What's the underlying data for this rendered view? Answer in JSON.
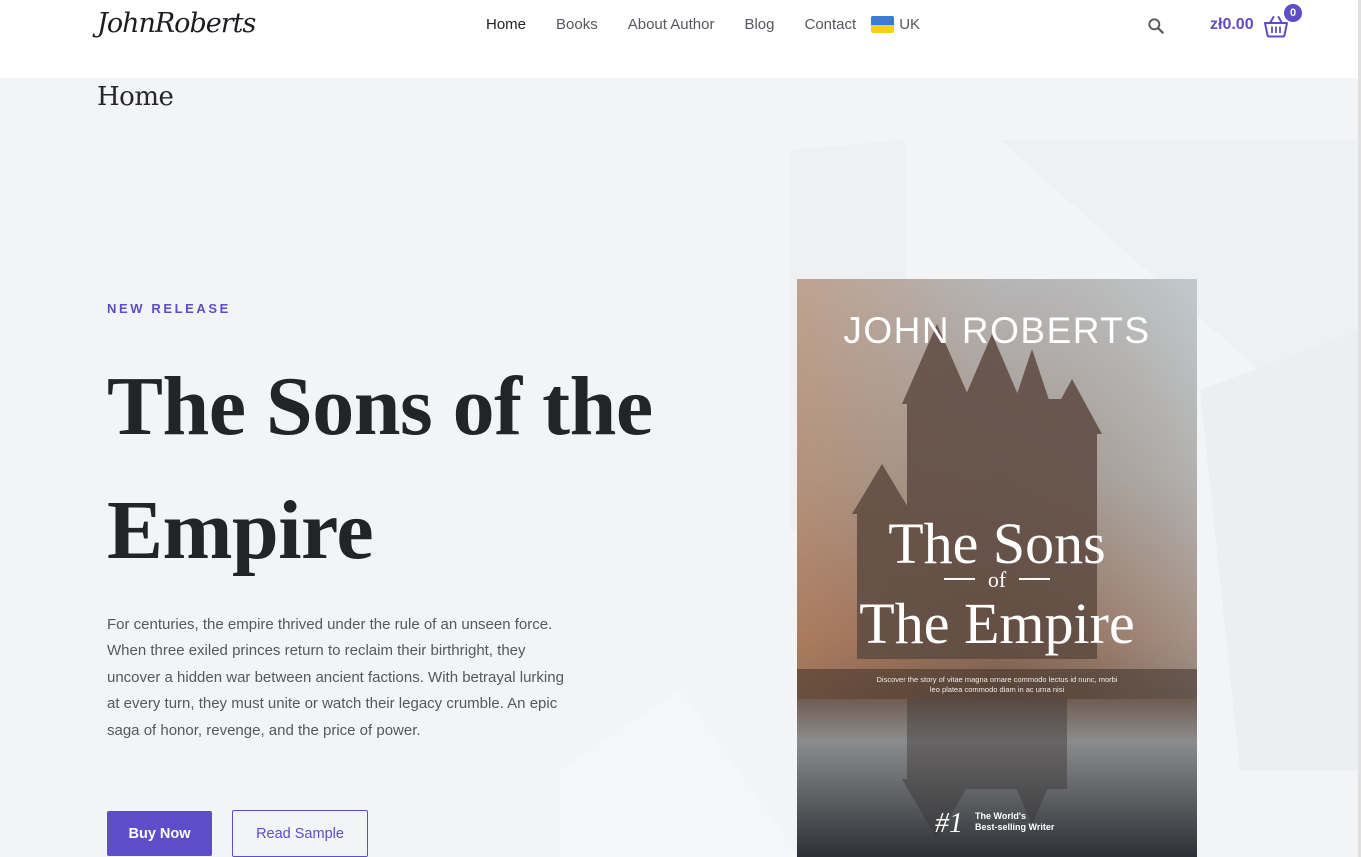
{
  "header": {
    "logo": "JohnRoberts",
    "nav": [
      {
        "label": "Home",
        "active": true
      },
      {
        "label": "Books",
        "active": false
      },
      {
        "label": "About Author",
        "active": false
      },
      {
        "label": "Blog",
        "active": false
      },
      {
        "label": "Contact",
        "active": false
      }
    ],
    "language": {
      "label": "UK",
      "flag": "ukraine-flag"
    },
    "search_icon": "search-icon",
    "cart": {
      "price": "zł0.00",
      "count": "0",
      "icon": "basket-icon"
    }
  },
  "breadcrumb": "Home",
  "hero": {
    "eyebrow": "NEW RELEASE",
    "title": "The Sons of the Empire",
    "description": "For centuries, the empire thrived under the rule of an unseen force. When three exiled princes return to reclaim their birthright, they uncover a hidden war between ancient factions. With betrayal lurking at every turn, they must unite or watch their legacy crumble. An epic saga of honor, revenge, and the price of power.",
    "buy_label": "Buy Now",
    "sample_label": "Read Sample"
  },
  "cover": {
    "author": "JOHN ROBERTS",
    "title_line1": "The Sons",
    "title_of": "of",
    "title_line2": "The Empire",
    "blurb_line1": "Discover the story of vitae magna ornare commodo lectus id nunc, morbi",
    "blurb_line2": "leo platea commodo diam in ac urna nisi",
    "rank": "#1",
    "rank_line1": "The World's",
    "rank_line2": "Best-selling Writer"
  },
  "colors": {
    "accent": "#5d4dc9",
    "text": "#232428",
    "muted": "#55585e",
    "background": "#f2f4f5"
  }
}
